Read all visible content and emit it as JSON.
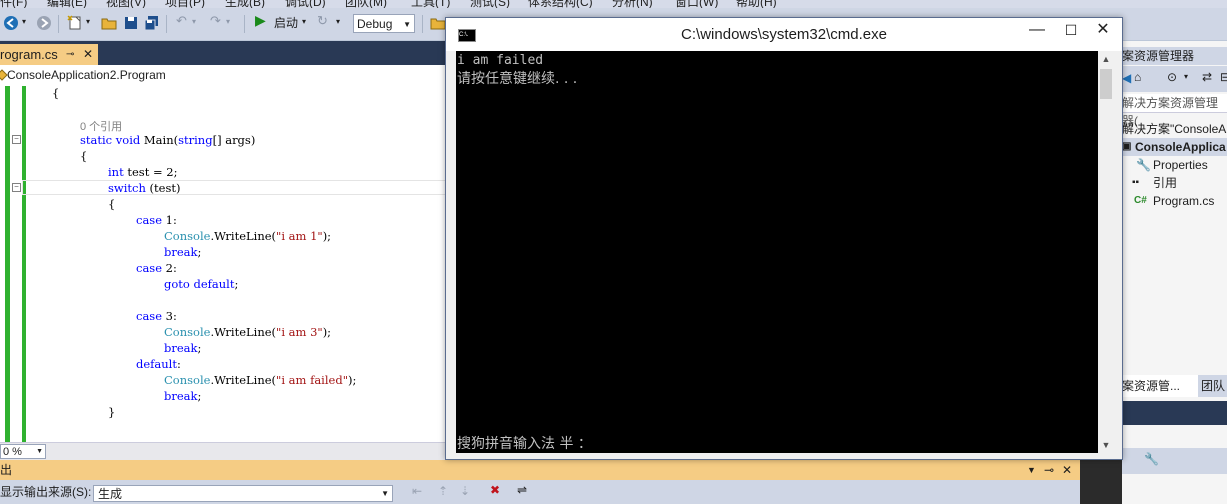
{
  "menu": {
    "items": [
      "件(F)",
      "编辑(E)",
      "视图(V)",
      "项目(P)",
      "生成(B)",
      "调试(D)",
      "团队(M)",
      "工具(T)",
      "测试(S)",
      "体系结构(C)",
      "分析(N)",
      "窗口(W)",
      "帮助(H)"
    ]
  },
  "toolbar": {
    "start_label": "启动",
    "config_value": "Debug"
  },
  "editor": {
    "tab_label": "rogram.cs",
    "tab_pin": "⊸",
    "tab_close": "✕",
    "nav_class": "ConsoleApplication2.Program",
    "zoom": "0 %",
    "code": {
      "l1": "{",
      "ref": "0 个引用",
      "l2_kw1": "static",
      "l2_kw2": "void",
      "l2_rest": " Main(",
      "l2_kw3": "string",
      "l2_rest2": "[] args)",
      "l3": "{",
      "l4_kw": "int",
      "l4_rest": " test = 2;",
      "l5_kw": "switch",
      "l5_rest": " (test)",
      "l6": "{",
      "case1_kw": "case",
      "case1_rest": " 1:",
      "console": "Console",
      "wl": ".WriteLine(",
      "s1": "\"i am 1\"",
      "close": ");",
      "brk": "break",
      "semi": ";",
      "case2_kw": "case",
      "case2_rest": " 2:",
      "goto_kw": "goto",
      "default_kw": "default",
      "case3_kw": "case",
      "case3_rest": " 3:",
      "s3": "\"i am 3\"",
      "default_label": "default",
      "colon": ":",
      "sf": "\"i am failed\"",
      "l_end": "}"
    }
  },
  "output": {
    "title": "出",
    "source_label": "显示输出来源(S):",
    "source_value": "生成"
  },
  "solution": {
    "title": "案资源管理器",
    "search_placeholder": "解决方案资源管理器(",
    "items": [
      {
        "label": "解决方案\"ConsoleAp"
      },
      {
        "label": "ConsoleApplica"
      },
      {
        "label": "Properties"
      },
      {
        "label": "引用"
      },
      {
        "label": "Program.cs"
      }
    ],
    "tab_active": "案资源管...",
    "tab_other": "团队"
  },
  "cmd": {
    "title": "C:\\windows\\system32\\cmd.exe",
    "icon_text": "C:\\.",
    "line1": "i am failed",
    "line2": "请按任意键继续. . .",
    "ime": "搜狗拼音输入法 半 ：",
    "ctrl_min": "—",
    "ctrl_max": "☐",
    "ctrl_close": "✕"
  },
  "colors": {
    "accent_tab": "#f5cc84",
    "ide_dark": "#293955",
    "toolbar": "#cfd6e5",
    "change_bar": "#2fb12f"
  }
}
